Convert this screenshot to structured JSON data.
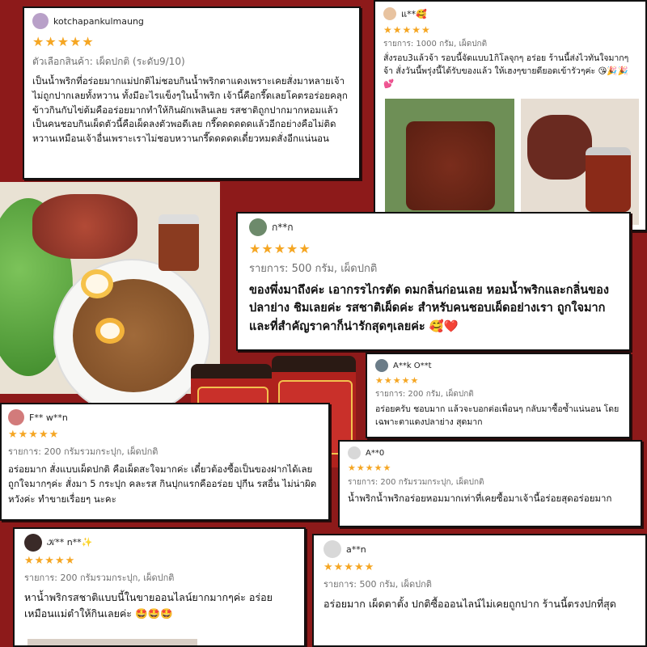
{
  "colors": {
    "background": "#8d1a1a",
    "star": "#f5a623",
    "meta": "#6f6f6f"
  },
  "rating_stars": "★★★★★",
  "reviews": [
    {
      "user": "kotchapankulmaung",
      "meta": "ตัวเลือกสินค้า: เผ็ดปกติ (ระดับ9/10)",
      "text": "เป็นน้ำพริกที่อร่อยมากแม่ปกติไม่ชอบกินน้ำพริกตาแดงเพราะเคยสั่งมาหลายเจ้าไม่ถูกปากเลยทั้งหวาน ทั้งมีอะไรแข็งๆในน้ำพริก เจ้านี้คือกรี๊ดเลยโคตรอร่อยคลุกข้าวกินกับไข่ต้มคืออร่อยมากทำให้กินผักเพลินเลย รสชาติถูกปากมากหอมแล้วเป็นคนชอบกินเผ็ดตัวนี้คือเผ็ดลงตัวพอดีเลย กรี๊ดดดดดดแล้วอีกอย่างคือไม่ติดหวานเหมือนเจ้าอื่นเพราะเราไม่ชอบหวานกรี๊ดดดดดเดี๋ยวหมดสั่งอีกแน่นอน"
    },
    {
      "user": "แ**🥰",
      "meta": "รายการ: 1000 กรัม, เผ็ดปกติ",
      "text": "สั่งรอบ3แล้วจ้า รอบนี้จัดแบบ1กิโลจุกๆ อร่อย ร้านนี้ส่งไวทันใจมากๆจ้า สั่งวันนี้พรุ่งนี้ได้รับของแล้ว ให้เฮงๆขายดียอดเข้ารัวๆค่ะ 😘🎉🎉💕"
    },
    {
      "user": "ก**ก",
      "meta": "รายการ: 500 กรัม, เผ็ดปกติ",
      "text": "ของพึ่งมาถึงค่ะ เอากรรไกรตัด ดมกลิ่นก่อนเลย หอมน้ำพริกและกลิ่นของปลาย่าง ชิมเลยค่ะ รสชาติเผ็ดค่ะ สำหรับคนชอบเผ็ดอย่างเรา ถูกใจมาก และที่สำคัญราคาก็น่ารักสุดๆเลยค่ะ 🥰❤️"
    },
    {
      "user": "A**k O**t",
      "meta": "รายการ: 200 กรัม, เผ็ดปกติ",
      "text": "อร่อยครับ ชอบมาก แล้วจะบอกต่อเพื่อนๆ กลับมาซื้อซ้ำแน่นอน โดยเฉพาะตาแดงปลาย่าง สุดมาก"
    },
    {
      "user": "F** w**n",
      "meta": "รายการ: 200 กรัมรวมกระปุก, เผ็ดปกติ",
      "text": "อร่อยมาก สั่งแบบเผ็ดปกติ คือเผ็ดสะใจมากค่ะ  เดี๋ยวต้องซื้อเป็นของฝากได้เลย ถูกใจมากๆค่ะ สั่งมา 5 กระปุก คละรส  กินปุกแรกคืออร่อย ปุกีน รสอื่น ไม่น่าผิดหวังค่ะ ทำขายเรื่อยๆ นะคะ"
    },
    {
      "user": "A**0",
      "meta": "รายการ: 200 กรัมรวมกระปุก, เผ็ดปกติ",
      "text": "น้ำพริกน้ำพริกอร่อยหอมมากเท่าที่เคยซื้อมาเจ้านี้อร่อยสุดอร่อยมาก"
    },
    {
      "user": "𝒦** n**✨",
      "meta": "รายการ: 200 กรัมรวมกระปุก, เผ็ดปกติ",
      "text": "หาน้ำพริกรสชาติแบบนี้ในขายออนไลน์ยากมากๆค่ะ อร่อยเหมือนแม่ตำให้กินเลยค่ะ 🤩🤩🤩"
    },
    {
      "user": "a**n",
      "meta": "รายการ: 500 กรัม, เผ็ดปกติ",
      "text": "อร่อยมาก เผ็ดตาตั้ง ปกติซื้อออนไลน์ไม่เคยถูกปาก ร้านนี้ตรงปกที่สุด"
    }
  ]
}
